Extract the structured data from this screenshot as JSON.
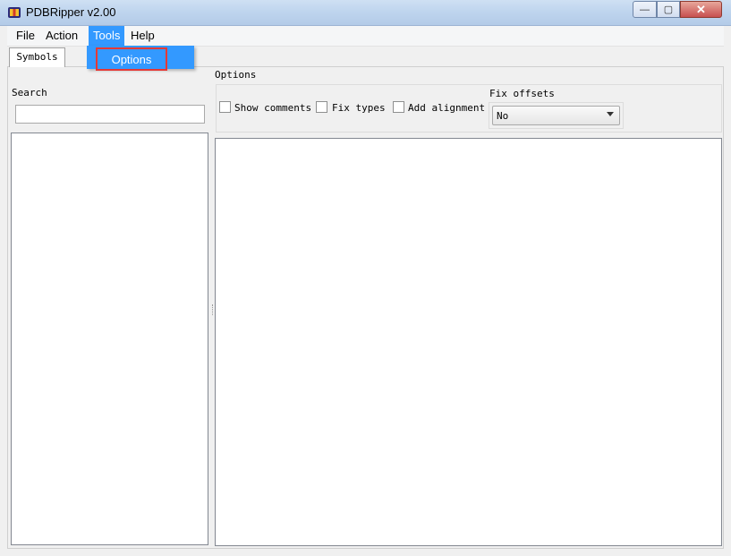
{
  "window": {
    "title": "PDBRipper v2.00",
    "close_glyph": "✕",
    "max_glyph": "▢",
    "min_glyph": "—"
  },
  "menu": {
    "file": "File",
    "action": "Action",
    "tools": "Tools",
    "help": "Help"
  },
  "tools_menu": {
    "options": "Options"
  },
  "tabs": {
    "symbols": "Symbols"
  },
  "search": {
    "label": "Search",
    "value": ""
  },
  "options": {
    "group_label": "Options",
    "show_comments": "Show comments",
    "fix_types": "Fix types",
    "add_alignment": "Add alignment",
    "fix_offsets_label": "Fix offsets",
    "fix_offsets_value": "No"
  },
  "colors": {
    "menu_highlight": "#3399ff",
    "callout": "#e53935"
  }
}
